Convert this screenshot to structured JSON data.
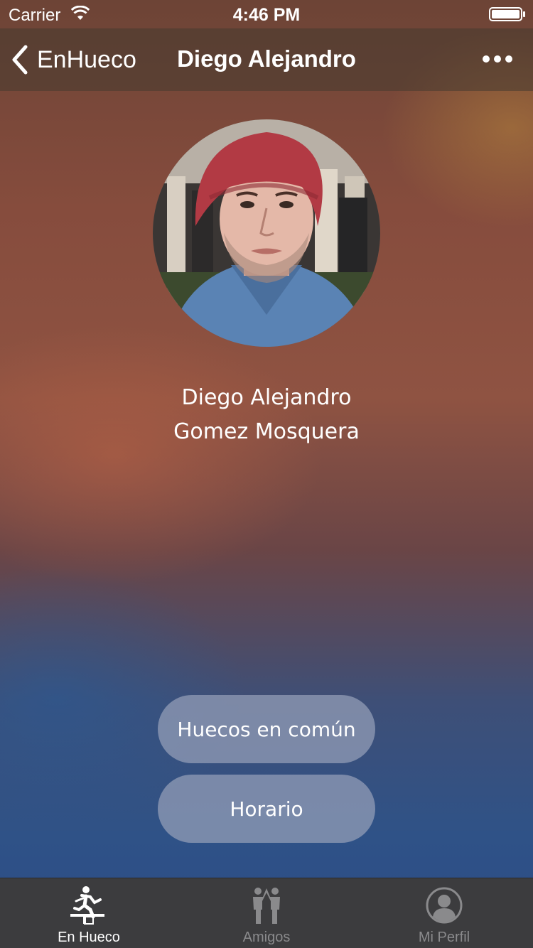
{
  "status_bar": {
    "carrier": "Carrier",
    "time": "4:46 PM"
  },
  "nav": {
    "back_label": "EnHueco",
    "title": "Diego Alejandro",
    "more_icon": "more-horizontal-icon"
  },
  "profile": {
    "first_names": "Diego Alejandro",
    "last_names": "Gomez Mosquera"
  },
  "actions": {
    "common_gaps": "Huecos en común",
    "schedule": "Horario"
  },
  "tab_bar": {
    "items": [
      {
        "label": "En Hueco",
        "icon": "running-figure-icon",
        "active": true
      },
      {
        "label": "Amigos",
        "icon": "friends-icon",
        "active": false
      },
      {
        "label": "Mi Perfil",
        "icon": "profile-icon",
        "active": false
      }
    ]
  },
  "colors": {
    "tab_active": "#ffffff",
    "tab_inactive": "#8a8a8c",
    "button_bg": "#96a0b9"
  }
}
